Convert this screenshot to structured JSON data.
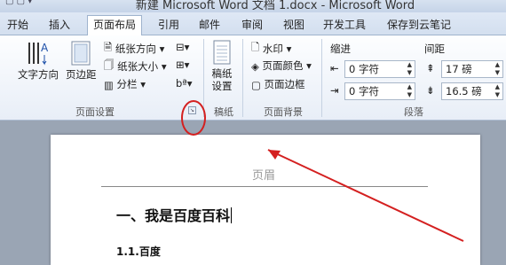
{
  "window": {
    "title": "新建 Microsoft Word 文档 1.docx - Microsoft Word"
  },
  "tabs": [
    "开始",
    "插入",
    "页面布局",
    "引用",
    "邮件",
    "审阅",
    "视图",
    "开发工具",
    "保存到云笔记"
  ],
  "ribbon": {
    "page_setup": {
      "text_direction": "文字方向",
      "margins": "页边距",
      "orientation": "纸张方向",
      "size": "纸张大小",
      "columns": "分栏",
      "label": "页面设置"
    },
    "draft_paper": {
      "button": "稿纸\n设置",
      "label": "稿纸"
    },
    "page_background": {
      "watermark": "水印",
      "page_color": "页面颜色",
      "page_borders": "页面边框",
      "label": "页面背景"
    },
    "paragraph": {
      "indent_label": "缩进",
      "spacing_label": "间距",
      "indent_left": "0 字符",
      "indent_right": "0 字符",
      "spacing_before": "17 磅",
      "spacing_after": "16.5 磅",
      "label": "段落"
    }
  },
  "document": {
    "header_label": "页眉",
    "heading1": "一、我是百度百科",
    "heading2": "1.1.百度"
  },
  "annotation_color": "#d42020"
}
